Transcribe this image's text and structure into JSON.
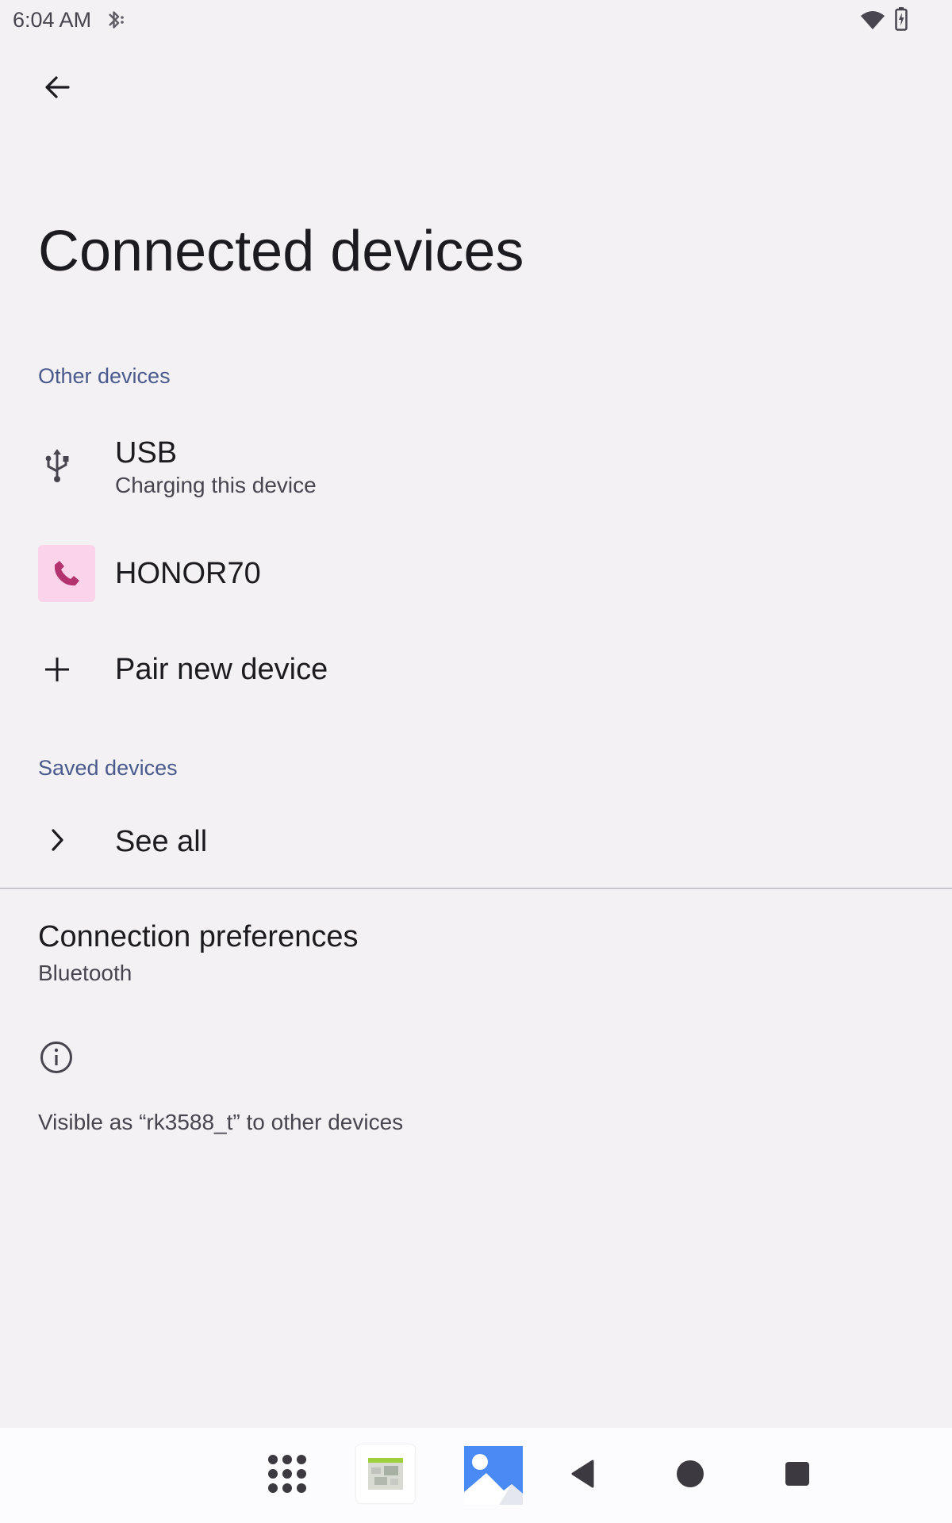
{
  "status_bar": {
    "time": "6:04 AM",
    "icons": [
      "bluetooth-icon",
      "wifi-icon",
      "battery-charging-icon"
    ]
  },
  "header": {
    "back_icon": "arrow-back-icon",
    "title": "Connected devices"
  },
  "other_devices": {
    "header": "Other devices",
    "items": [
      {
        "icon": "usb-icon",
        "title": "USB",
        "subtitle": "Charging this device"
      },
      {
        "icon": "phone-icon",
        "title": "HONOR70"
      },
      {
        "icon": "plus-icon",
        "title": "Pair new device"
      }
    ]
  },
  "saved_devices": {
    "header": "Saved devices",
    "see_all": {
      "icon": "chevron-right-icon",
      "title": "See all"
    }
  },
  "connection_preferences": {
    "title": "Connection preferences",
    "subtitle": "Bluetooth"
  },
  "footer_info": {
    "icon": "info-icon",
    "text": "Visible as “rk3588_t” to other devices"
  },
  "navigation_bar": {
    "items": [
      "apps-grid-icon",
      "app-thumbnail-icon",
      "gallery-icon",
      "nav-back-icon",
      "nav-home-icon",
      "nav-recents-icon"
    ]
  },
  "colors": {
    "background": "#f3f1f4",
    "accent": "#4a5a8c",
    "phone_icon_bg": "#fbd4ea",
    "phone_icon": "#b3336f"
  }
}
